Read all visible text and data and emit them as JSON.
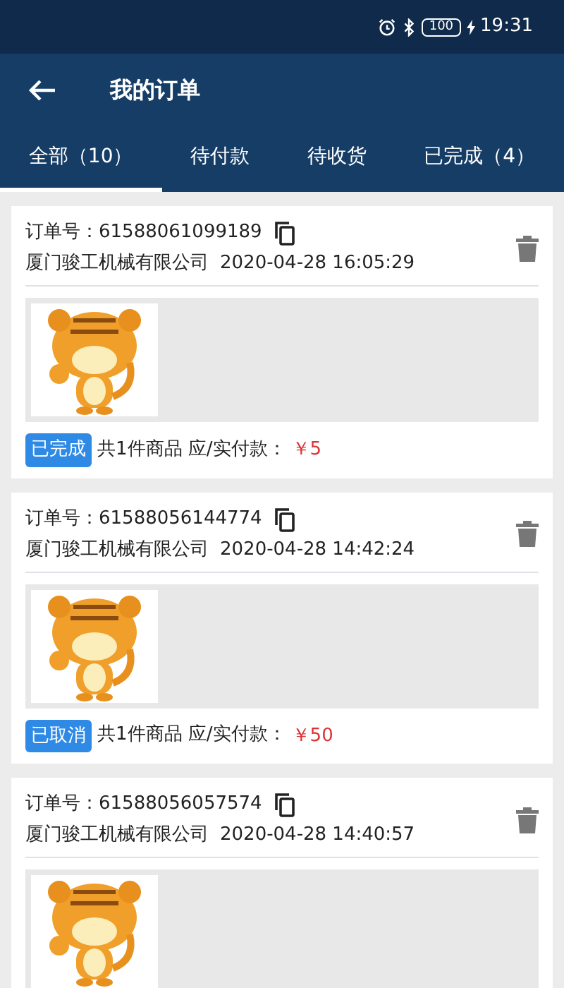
{
  "status_bar": {
    "battery": "100",
    "time": "19:31"
  },
  "header": {
    "title": "我的订单"
  },
  "tabs": [
    {
      "label": "全部（10）",
      "selected": true
    },
    {
      "label": "待付款",
      "selected": false
    },
    {
      "label": "待收货",
      "selected": false
    },
    {
      "label": "已完成（4）",
      "selected": false
    }
  ],
  "orders": [
    {
      "order_label": "订单号：",
      "order_no": "61588061099189",
      "company": "厦门骏工机械有限公司",
      "time": "2020-04-28 16:05:29",
      "status": "已完成",
      "summary": "共1件商品 应/实付款：",
      "price": "￥5"
    },
    {
      "order_label": "订单号：",
      "order_no": "61588056144774",
      "company": "厦门骏工机械有限公司",
      "time": "2020-04-28 14:42:24",
      "status": "已取消",
      "summary": "共1件商品 应/实付款：",
      "price": "￥50"
    },
    {
      "order_label": "订单号：",
      "order_no": "61588056057574",
      "company": "厦门骏工机械有限公司",
      "time": "2020-04-28 14:40:57"
    }
  ]
}
